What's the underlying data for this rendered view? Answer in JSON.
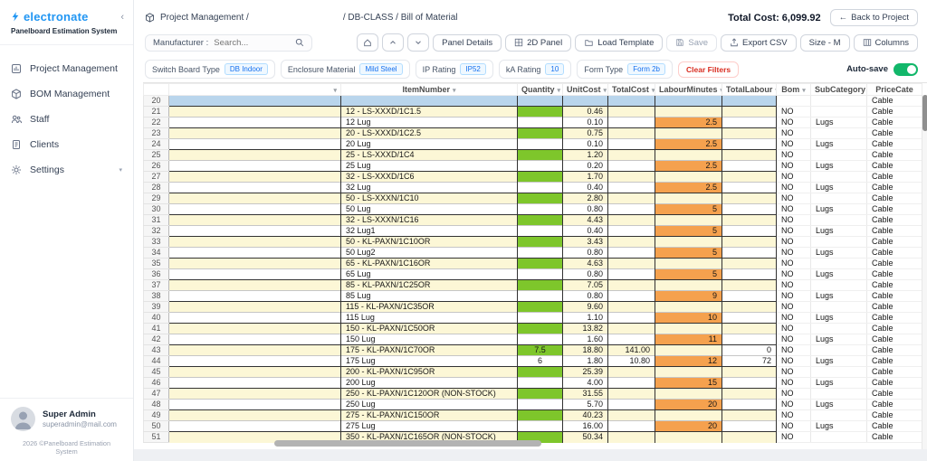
{
  "sidebar": {
    "logo": "electronate",
    "subtitle": "Panelboard Estimation System",
    "collapse_glyph": "‹",
    "items": [
      {
        "label": "Project Management"
      },
      {
        "label": "BOM Management"
      },
      {
        "label": "Staff"
      },
      {
        "label": "Clients"
      },
      {
        "label": "Settings"
      }
    ],
    "user": {
      "name": "Super Admin",
      "email": "superadmin@mail.com"
    },
    "copyright": "2026 ©Panelboard Estimation System"
  },
  "header": {
    "breadcrumb_part1": "Project Management /",
    "breadcrumb_part2": "/ DB-CLASS / Bill of Material",
    "total_cost": "Total Cost: 6,099.92",
    "back_arrow": "←",
    "back_button": "Back to Project"
  },
  "toolbar": {
    "manufacturer_label": "Manufacturer :",
    "search_placeholder": "Search...",
    "panel_details": "Panel Details",
    "panel_2d": "2D Panel",
    "load_template": "Load Template",
    "save": "Save",
    "export_csv": "Export CSV",
    "size": "Size - M",
    "columns": "Columns"
  },
  "filters": {
    "chips": [
      {
        "label": "Switch Board Type",
        "value": "DB Indoor"
      },
      {
        "label": "Enclosure Material",
        "value": "Mild Steel"
      },
      {
        "label": "IP Rating",
        "value": "IP52"
      },
      {
        "label": "kA Rating",
        "value": "10"
      },
      {
        "label": "Form Type",
        "value": "Form 2b"
      }
    ],
    "clear_label": "Clear Filters",
    "autosave_label": "Auto-save"
  },
  "theme": {
    "accent_blue": "#2196F3",
    "toggle_green": "#12B76A",
    "row_yellow": "#FCF7D6",
    "quantity_green": "#7EC62B",
    "labour_orange": "#F5A14E",
    "selected_blue": "#B9D5EC",
    "clear_red": "#D92D20"
  },
  "table": {
    "columns": [
      {
        "key": "rownum",
        "label": "",
        "sortable": false
      },
      {
        "key": "description",
        "label": "",
        "sortable": true
      },
      {
        "key": "itemnumber",
        "label": "ItemNumber",
        "sortable": true
      },
      {
        "key": "quantity",
        "label": "Quantity",
        "sortable": true
      },
      {
        "key": "unitcost",
        "label": "UnitCost",
        "sortable": true
      },
      {
        "key": "totalcost",
        "label": "TotalCost",
        "sortable": true
      },
      {
        "key": "labourminutes",
        "label": "LabourMinutes",
        "sortable": true
      },
      {
        "key": "totallabour",
        "label": "TotalLabour",
        "sortable": true
      },
      {
        "key": "bom",
        "label": "Bom",
        "sortable": true
      },
      {
        "key": "subcategory",
        "label": "SubCategory",
        "sortable": true
      },
      {
        "key": "pricecate",
        "label": "PriceCate",
        "sortable": false
      }
    ],
    "rows": [
      {
        "n": "20",
        "item": "",
        "qty": "",
        "unit": "",
        "total": "",
        "lab": "",
        "tlab": "",
        "bom": "",
        "sub": "",
        "price": "Cable",
        "kind": "sel"
      },
      {
        "n": "21",
        "item": "12 - LS-XXXD/1C1.5",
        "qty": "",
        "unit": "0.46",
        "total": "",
        "lab": "",
        "tlab": "",
        "bom": "NO",
        "sub": "",
        "price": "Cable",
        "kind": "item"
      },
      {
        "n": "22",
        "item": "12 Lug",
        "qty": "",
        "unit": "0.10",
        "total": "",
        "lab": "2.5",
        "tlab": "",
        "bom": "NO",
        "sub": "Lugs",
        "price": "Cable",
        "kind": "lug"
      },
      {
        "n": "23",
        "item": "20 - LS-XXXD/1C2.5",
        "qty": "",
        "unit": "0.75",
        "total": "",
        "lab": "",
        "tlab": "",
        "bom": "NO",
        "sub": "",
        "price": "Cable",
        "kind": "item"
      },
      {
        "n": "24",
        "item": "20 Lug",
        "qty": "",
        "unit": "0.10",
        "total": "",
        "lab": "2.5",
        "tlab": "",
        "bom": "NO",
        "sub": "Lugs",
        "price": "Cable",
        "kind": "lug"
      },
      {
        "n": "25",
        "item": "25 - LS-XXXD/1C4",
        "qty": "",
        "unit": "1.20",
        "total": "",
        "lab": "",
        "tlab": "",
        "bom": "NO",
        "sub": "",
        "price": "Cable",
        "kind": "item"
      },
      {
        "n": "26",
        "item": "25 Lug",
        "qty": "",
        "unit": "0.20",
        "total": "",
        "lab": "2.5",
        "tlab": "",
        "bom": "NO",
        "sub": "Lugs",
        "price": "Cable",
        "kind": "lug"
      },
      {
        "n": "27",
        "item": "32 - LS-XXXD/1C6",
        "qty": "",
        "unit": "1.70",
        "total": "",
        "lab": "",
        "tlab": "",
        "bom": "NO",
        "sub": "",
        "price": "Cable",
        "kind": "item"
      },
      {
        "n": "28",
        "item": "32 Lug",
        "qty": "",
        "unit": "0.40",
        "total": "",
        "lab": "2.5",
        "tlab": "",
        "bom": "NO",
        "sub": "Lugs",
        "price": "Cable",
        "kind": "lug"
      },
      {
        "n": "29",
        "item": "50 - LS-XXXN/1C10",
        "qty": "",
        "unit": "2.80",
        "total": "",
        "lab": "",
        "tlab": "",
        "bom": "NO",
        "sub": "",
        "price": "Cable",
        "kind": "item"
      },
      {
        "n": "30",
        "item": "50 Lug",
        "qty": "",
        "unit": "0.80",
        "total": "",
        "lab": "5",
        "tlab": "",
        "bom": "NO",
        "sub": "Lugs",
        "price": "Cable",
        "kind": "lug"
      },
      {
        "n": "31",
        "item": "32 - LS-XXXN/1C16",
        "qty": "",
        "unit": "4.43",
        "total": "",
        "lab": "",
        "tlab": "",
        "bom": "NO",
        "sub": "",
        "price": "Cable",
        "kind": "item"
      },
      {
        "n": "32",
        "item": "32 Lug1",
        "qty": "",
        "unit": "0.40",
        "total": "",
        "lab": "5",
        "tlab": "",
        "bom": "NO",
        "sub": "Lugs",
        "price": "Cable",
        "kind": "lug"
      },
      {
        "n": "33",
        "item": "50 - KL-PAXN/1C10OR",
        "qty": "",
        "unit": "3.43",
        "total": "",
        "lab": "",
        "tlab": "",
        "bom": "NO",
        "sub": "",
        "price": "Cable",
        "kind": "item"
      },
      {
        "n": "34",
        "item": "50 Lug2",
        "qty": "",
        "unit": "0.80",
        "total": "",
        "lab": "5",
        "tlab": "",
        "bom": "NO",
        "sub": "Lugs",
        "price": "Cable",
        "kind": "lug"
      },
      {
        "n": "35",
        "item": "65 - KL-PAXN/1C16OR",
        "qty": "",
        "unit": "4.63",
        "total": "",
        "lab": "",
        "tlab": "",
        "bom": "NO",
        "sub": "",
        "price": "Cable",
        "kind": "item"
      },
      {
        "n": "36",
        "item": "65 Lug",
        "qty": "",
        "unit": "0.80",
        "total": "",
        "lab": "5",
        "tlab": "",
        "bom": "NO",
        "sub": "Lugs",
        "price": "Cable",
        "kind": "lug"
      },
      {
        "n": "37",
        "item": "85 - KL-PAXN/1C25OR",
        "qty": "",
        "unit": "7.05",
        "total": "",
        "lab": "",
        "tlab": "",
        "bom": "NO",
        "sub": "",
        "price": "Cable",
        "kind": "item"
      },
      {
        "n": "38",
        "item": "85 Lug",
        "qty": "",
        "unit": "0.80",
        "total": "",
        "lab": "9",
        "tlab": "",
        "bom": "NO",
        "sub": "Lugs",
        "price": "Cable",
        "kind": "lug"
      },
      {
        "n": "39",
        "item": "115 - KL-PAXN/1C35OR",
        "qty": "",
        "unit": "9.60",
        "total": "",
        "lab": "",
        "tlab": "",
        "bom": "NO",
        "sub": "",
        "price": "Cable",
        "kind": "item"
      },
      {
        "n": "40",
        "item": "115 Lug",
        "qty": "",
        "unit": "1.10",
        "total": "",
        "lab": "10",
        "tlab": "",
        "bom": "NO",
        "sub": "Lugs",
        "price": "Cable",
        "kind": "lug"
      },
      {
        "n": "41",
        "item": "150 - KL-PAXN/1C50OR",
        "qty": "",
        "unit": "13.82",
        "total": "",
        "lab": "",
        "tlab": "",
        "bom": "NO",
        "sub": "",
        "price": "Cable",
        "kind": "item"
      },
      {
        "n": "42",
        "item": "150 Lug",
        "qty": "",
        "unit": "1.60",
        "total": "",
        "lab": "11",
        "tlab": "",
        "bom": "NO",
        "sub": "Lugs",
        "price": "Cable",
        "kind": "lug"
      },
      {
        "n": "43",
        "item": "175 - KL-PAXN/1C70OR",
        "qty": "7.5",
        "unit": "18.80",
        "total": "141.00",
        "lab": "",
        "tlab": "0",
        "bom": "NO",
        "sub": "",
        "price": "Cable",
        "kind": "item"
      },
      {
        "n": "44",
        "item": "175 Lug",
        "qty": "6",
        "unit": "1.80",
        "total": "10.80",
        "lab": "12",
        "tlab": "72",
        "bom": "NO",
        "sub": "Lugs",
        "price": "Cable",
        "kind": "lug"
      },
      {
        "n": "45",
        "item": "200 - KL-PAXN/1C95OR",
        "qty": "",
        "unit": "25.39",
        "total": "",
        "lab": "",
        "tlab": "",
        "bom": "NO",
        "sub": "",
        "price": "Cable",
        "kind": "item"
      },
      {
        "n": "46",
        "item": "200 Lug",
        "qty": "",
        "unit": "4.00",
        "total": "",
        "lab": "15",
        "tlab": "",
        "bom": "NO",
        "sub": "Lugs",
        "price": "Cable",
        "kind": "lug"
      },
      {
        "n": "47",
        "item": "250 - KL-PAXN/1C120OR (NON-STOCK)",
        "qty": "",
        "unit": "31.55",
        "total": "",
        "lab": "",
        "tlab": "",
        "bom": "NO",
        "sub": "",
        "price": "Cable",
        "kind": "item"
      },
      {
        "n": "48",
        "item": "250 Lug",
        "qty": "",
        "unit": "5.70",
        "total": "",
        "lab": "20",
        "tlab": "",
        "bom": "NO",
        "sub": "Lugs",
        "price": "Cable",
        "kind": "lug"
      },
      {
        "n": "49",
        "item": "275 - KL-PAXN/1C150OR",
        "qty": "",
        "unit": "40.23",
        "total": "",
        "lab": "",
        "tlab": "",
        "bom": "NO",
        "sub": "",
        "price": "Cable",
        "kind": "item"
      },
      {
        "n": "50",
        "item": "275 Lug",
        "qty": "",
        "unit": "16.00",
        "total": "",
        "lab": "20",
        "tlab": "",
        "bom": "NO",
        "sub": "Lugs",
        "price": "Cable",
        "kind": "lug"
      },
      {
        "n": "51",
        "item": "350 - KL-PAXN/1C165OR (NON-STOCK)",
        "qty": "",
        "unit": "50.34",
        "total": "",
        "lab": "",
        "tlab": "",
        "bom": "NO",
        "sub": "",
        "price": "Cable",
        "kind": "item"
      }
    ]
  }
}
